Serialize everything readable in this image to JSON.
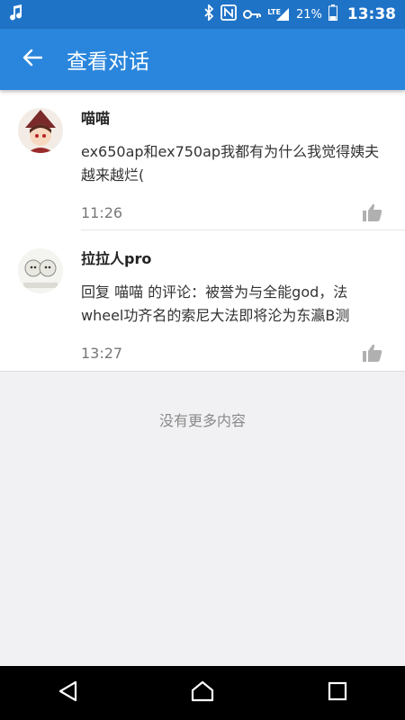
{
  "status_bar": {
    "battery_percent": "21%",
    "time": "13:38",
    "network_label": "LTE",
    "icons": [
      "music-note-icon",
      "bluetooth-icon",
      "nfc-icon",
      "key-icon",
      "signal-icon",
      "battery-icon"
    ]
  },
  "app_bar": {
    "title": "查看对话",
    "back_icon": "arrow-left-icon"
  },
  "comments": [
    {
      "username": "喵喵",
      "message": "ex650ap和ex750ap我都有为什么我觉得姨夫越来越烂(",
      "time": "11:26",
      "like_icon": "thumbs-up-icon"
    },
    {
      "username": "拉拉人pro",
      "message": "回复 喵喵 的评论：被誉为与全能god，法wheel功齐名的索尼大法即将沦为东瀛B测",
      "time": "13:27",
      "like_icon": "thumbs-up-icon"
    }
  ],
  "footer": {
    "no_more_text": "没有更多内容"
  },
  "nav_bar": {
    "icons": [
      "back-triangle-icon",
      "home-icon",
      "recents-icon"
    ]
  },
  "colors": {
    "status_bar": "#1f73c7",
    "app_bar": "#2a86dc",
    "background": "#f1f1f4"
  }
}
